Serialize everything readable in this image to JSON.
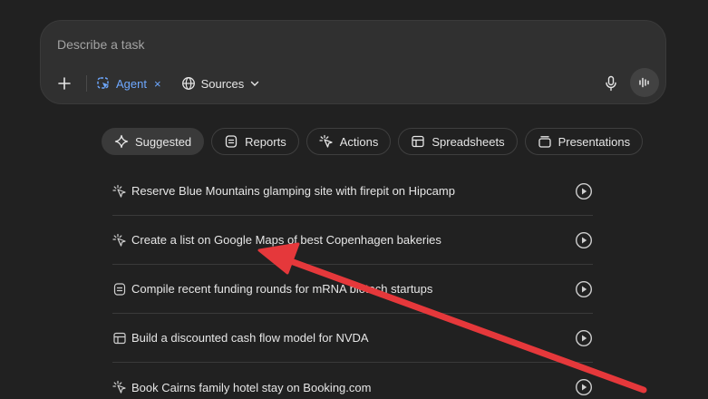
{
  "composer": {
    "placeholder": "Describe a task",
    "agent_label": "Agent",
    "agent_remove": "×",
    "sources_label": "Sources"
  },
  "tabs": [
    {
      "label": "Suggested",
      "icon": "sparkle-icon",
      "active": true
    },
    {
      "label": "Reports",
      "icon": "report-icon"
    },
    {
      "label": "Actions",
      "icon": "magic-cursor-icon"
    },
    {
      "label": "Spreadsheets",
      "icon": "table-icon"
    },
    {
      "label": "Presentations",
      "icon": "slides-icon"
    }
  ],
  "suggestions": [
    {
      "text": "Reserve Blue Mountains glamping site with firepit on Hipcamp",
      "icon": "magic-cursor-icon"
    },
    {
      "text": "Create a list on Google Maps of best Copenhagen bakeries",
      "icon": "magic-cursor-icon"
    },
    {
      "text": "Compile recent funding rounds for mRNA biotech startups",
      "icon": "report-icon"
    },
    {
      "text": "Build a discounted cash flow model for NVDA",
      "icon": "table-icon"
    },
    {
      "text": "Book Cairns family hotel stay on Booking.com",
      "icon": "magic-cursor-icon"
    }
  ],
  "colors": {
    "background": "#212121",
    "composer": "#303030",
    "agent_accent": "#6ea8ff",
    "annotation_arrow": "#e5383b"
  }
}
